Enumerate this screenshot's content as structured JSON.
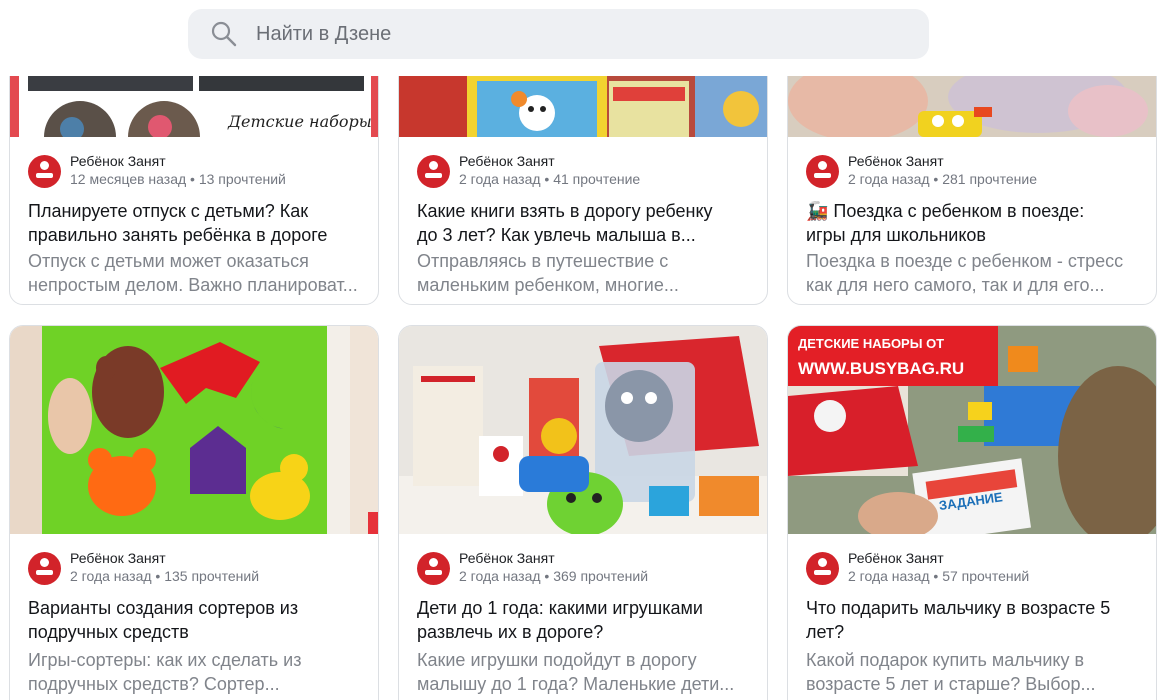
{
  "search": {
    "placeholder": "Найти в Дзене",
    "icon": "search-icon"
  },
  "cards": [
    {
      "channel": "Ребёнок Занят",
      "stats": "12 месяцев назад • 13 прочтений",
      "title_lines": [
        "Планируете отпуск с детьми? Как",
        "правильно занять ребёнка в дороге"
      ],
      "desc_lines": [
        "Отпуск с детьми может оказаться",
        "непростым делом. Важно планироват..."
      ],
      "image_caption": "Детские наборы"
    },
    {
      "channel": "Ребёнок Занят",
      "stats": "2 года назад • 41 прочтение",
      "title_lines": [
        "Какие книги взять в дорогу ребенку",
        "до 3 лет? Как увлечь малыша в..."
      ],
      "desc_lines": [
        "Отправляясь в путешествие с",
        "маленьким ребенком, многие..."
      ]
    },
    {
      "channel": "Ребёнок Занят",
      "stats": "2 года назад • 281 прочтение",
      "title_lines": [
        "🚂 Поездка с ребенком в поезде:",
        "игры для школьников"
      ],
      "desc_lines": [
        "Поездка в поезде с ребенком - стресс",
        "как для него самого, так и для его..."
      ]
    },
    {
      "channel": "Ребёнок Занят",
      "stats": "2 года назад • 135 прочтений",
      "title_lines": [
        "Варианты создания сортеров из",
        "подручных средств"
      ],
      "desc_lines": [
        "Игры-сортеры: как их сделать из",
        "подручных средств? Сортер..."
      ]
    },
    {
      "channel": "Ребёнок Занят",
      "stats": "2 года назад • 369 прочтений",
      "title_lines": [
        "Дети до 1 года: какими игрушками",
        "развлечь их в дороге?"
      ],
      "desc_lines": [
        "Какие игрушки подойдут в дорогу",
        "малышу до 1 года? Маленькие дети..."
      ]
    },
    {
      "channel": "Ребёнок Занят",
      "stats": "2 года назад • 57 прочтений",
      "title_lines": [
        "Что подарить мальчику в возрасте 5",
        "лет?"
      ],
      "desc_lines": [
        "Какой подарок купить мальчику в",
        "возрасте 5 лет и старше? Выбор..."
      ],
      "image_caption_lines": [
        "ДЕТСКИЕ НАБОРЫ ОТ",
        "WWW.BUSYBAG.RU"
      ],
      "image_sign": "ЗАДАНИЕ"
    }
  ],
  "colors": {
    "accent": "#d2232a",
    "search_bg": "#eef0f3",
    "muted": "#80848b"
  }
}
